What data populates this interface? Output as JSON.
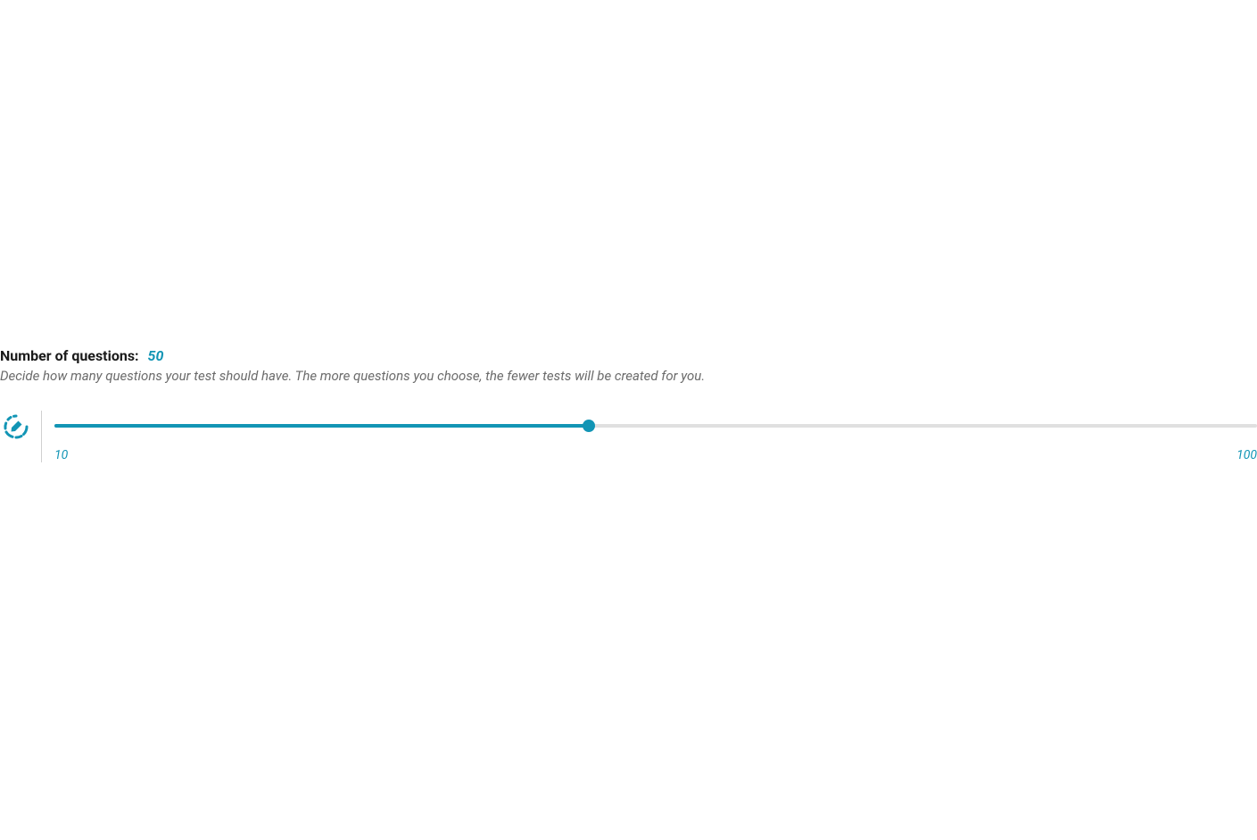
{
  "heading": {
    "label": "Number of questions:",
    "value": "50"
  },
  "description": "Decide how many questions your test should have. The more questions you choose, the fewer tests will be created for you.",
  "slider": {
    "min": 10,
    "max": 100,
    "value": 50,
    "minLabel": "10",
    "maxLabel": "100",
    "fillPercent": "44.4%"
  },
  "colors": {
    "accent": "#1295b5"
  }
}
